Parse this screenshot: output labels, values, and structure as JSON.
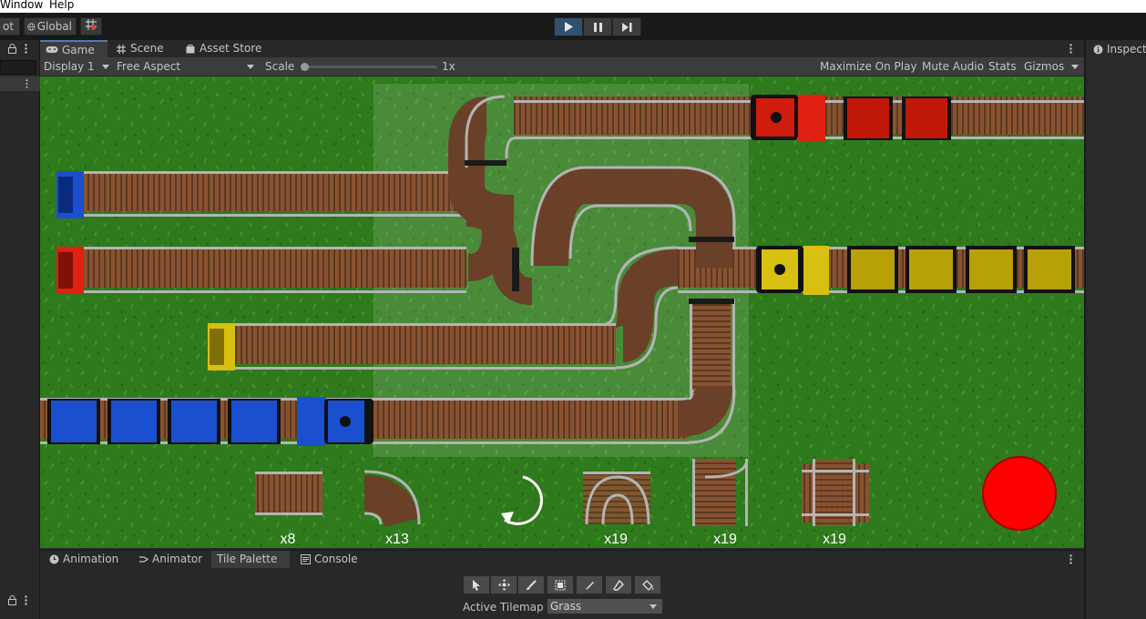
{
  "menu": {
    "window": "Window",
    "help": "Help"
  },
  "toolbar": {
    "pivot_fragment": "ot",
    "global": "Global"
  },
  "tabs": {
    "game": "Game",
    "scene": "Scene",
    "asset_store": "Asset Store",
    "inspector": "Inspector"
  },
  "gamebar": {
    "display": "Display 1",
    "aspect": "Free Aspect",
    "scale_label": "Scale",
    "scale_value": "1x",
    "maximize": "Maximize On Play",
    "mute": "Mute Audio",
    "stats": "Stats",
    "gizmos": "Gizmos"
  },
  "game": {
    "counts": [
      "x8",
      "x13",
      "x19",
      "x19",
      "x19"
    ],
    "colors": {
      "grass": "#2f7a1e",
      "red": "#e02010",
      "blue": "#1a4fd0",
      "yellow": "#d8c010",
      "rail": "#b0b0b0",
      "ties": "#7a4a30",
      "stop": "#ff0000"
    }
  },
  "bottom": {
    "tabs": [
      "Animation",
      "Animator",
      "Tile Palette",
      "Console"
    ],
    "active_tilemap_label": "Active Tilemap",
    "active_tilemap_value": "Grass"
  },
  "icons": [
    "lock-icon",
    "more-icon",
    "play-icon",
    "pause-icon",
    "step-icon",
    "globe-icon",
    "grid-icon",
    "gamepad-icon",
    "hash-icon",
    "bag-icon",
    "info-icon",
    "rotate-icon",
    "select-tool-icon",
    "move-tool-icon",
    "brush-tool-icon",
    "box-fill-icon",
    "picker-icon",
    "eraser-icon",
    "fill-icon"
  ]
}
